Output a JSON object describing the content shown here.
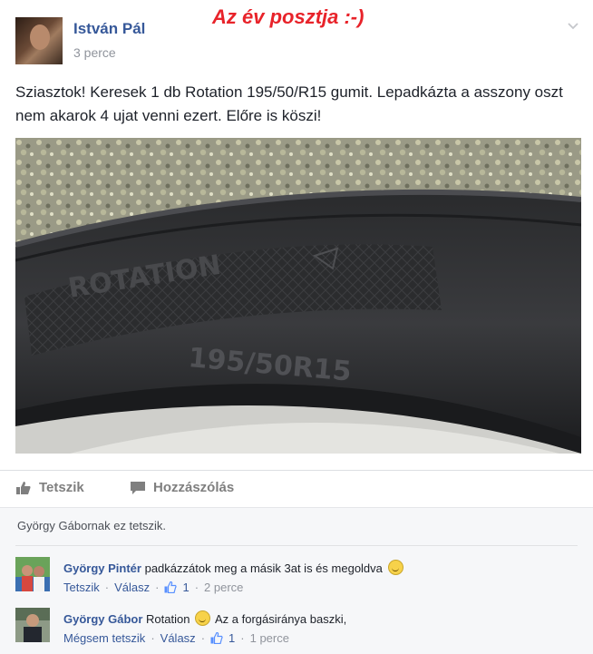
{
  "banner": "Az év posztja :-)",
  "post": {
    "author": "István Pál",
    "time": "3 perce",
    "text": "Sziasztok! Keresek 1 db Rotation 195/50/R15 gumit. Lepadkázta a asszony oszt nem akarok 4 ujat venni ezert. Előre is köszi!"
  },
  "photo": {
    "sidewall_brand": "ROTATION",
    "sidewall_size": "195/50R15"
  },
  "actions": {
    "like": "Tetszik",
    "comment": "Hozzászólás"
  },
  "likes_summary": "György Gábornak ez tetszik.",
  "comments": [
    {
      "name": "György Pintér",
      "text": "padkázzátok meg a másik 3at is és megoldva",
      "like_label": "Tetszik",
      "reply_label": "Válasz",
      "likes": "1",
      "time": "2 perce"
    },
    {
      "name": "György Gábor",
      "text_before": "Rotation",
      "text_after": "Az a forgásiránya baszki,",
      "like_label": "Mégsem tetszik",
      "reply_label": "Válasz",
      "likes": "1",
      "time": "1 perce"
    }
  ],
  "colors": {
    "link": "#365899",
    "banner": "#e8232a",
    "meta": "#90949c"
  }
}
